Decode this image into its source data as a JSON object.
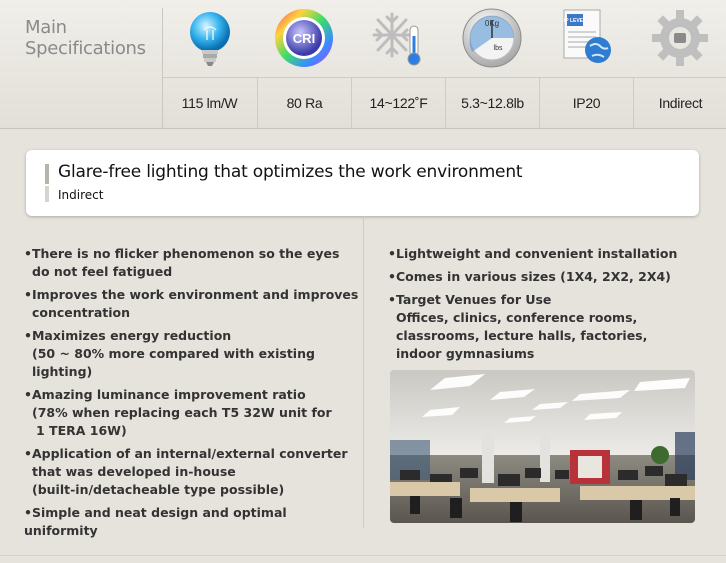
{
  "header": {
    "title_line1": "Main",
    "title_line2": "Specifications"
  },
  "icons": [
    {
      "name": "bulb-icon"
    },
    {
      "name": "cri-icon",
      "text": "CRI"
    },
    {
      "name": "snowflake-thermometer-icon"
    },
    {
      "name": "weight-scale-icon",
      "text_top": "0Kg",
      "text_bottom": "lbs"
    },
    {
      "name": "ip-level-icon",
      "text": "IP LEVEL"
    },
    {
      "name": "gear-icon"
    }
  ],
  "specs": [
    "115 lm/W",
    "80 Ra",
    "14~122˚F",
    "5.3~12.8lb",
    "IP20",
    "Indirect"
  ],
  "banner": {
    "title": "Glare-free lighting that optimizes the work environment",
    "subtitle": "Indirect"
  },
  "left_items": [
    {
      "line1": "•There is no flicker phenomenon so the eyes",
      "line2": "do not feel fatigued"
    },
    {
      "line1": "•Improves the work environment and improves",
      "line2": "concentration"
    },
    {
      "line1": "•Maximizes energy reduction",
      "line2": "(50 ~ 80% more compared with existing",
      "line3": "lighting)"
    },
    {
      "line1": "•Amazing luminance improvement ratio",
      "line2": "(78% when replacing each T5 32W unit for",
      "line3": " 1 TERA 16W)"
    },
    {
      "line1": "•Application of an internal/external converter",
      "line2": "that was developed in-house",
      "line3": "(built-in/detacheable type possible)"
    },
    {
      "line1": "•Simple and neat design and optimal uniformity"
    }
  ],
  "right_items": [
    {
      "line1": "•Lightweight and convenient installation"
    },
    {
      "line1": "•Comes in various sizes (1X4, 2X2, 2X4)"
    },
    {
      "line1": "•Target Venues for Use",
      "line2": "Offices, clinics, conference rooms,",
      "line3": "classrooms, lecture halls, factories,",
      "line4": "indoor gymnasiums"
    }
  ],
  "colors": {
    "background": "#e6e3dd",
    "banner_bg": "#ffffff",
    "title_gray": "#8a8a8a"
  }
}
